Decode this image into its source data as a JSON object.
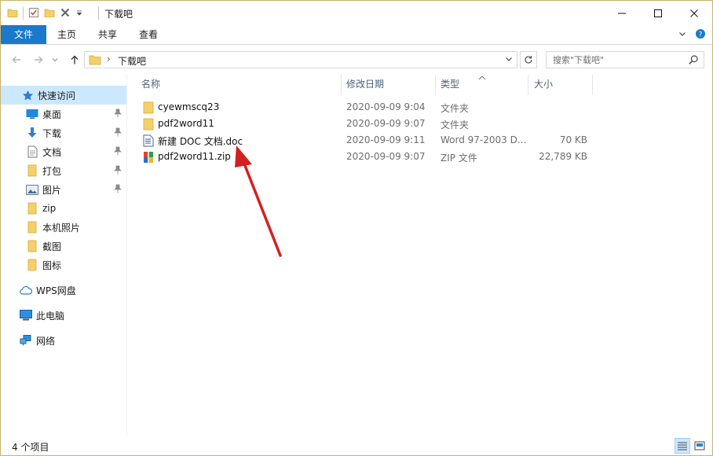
{
  "window": {
    "title": "下载吧",
    "controls": {
      "minimize": "minimize-icon",
      "maximize": "maximize-icon",
      "close": "close-icon"
    }
  },
  "ribbon": {
    "tabs": [
      {
        "label": "文件",
        "active": true
      },
      {
        "label": "主页"
      },
      {
        "label": "共享"
      },
      {
        "label": "查看"
      }
    ],
    "accent": "#1979ca"
  },
  "address": {
    "path": "下载吧",
    "search_placeholder": "搜索\"下载吧\""
  },
  "sidebar": {
    "quick_access": "快速访问",
    "items": [
      {
        "label": "桌面",
        "icon": "desktop-icon",
        "pinned": true
      },
      {
        "label": "下载",
        "icon": "download-icon",
        "pinned": true
      },
      {
        "label": "文档",
        "icon": "document-icon",
        "pinned": true
      },
      {
        "label": "打包",
        "icon": "folder-icon",
        "pinned": true
      },
      {
        "label": "图片",
        "icon": "pictures-icon",
        "pinned": true
      },
      {
        "label": "zip",
        "icon": "folder-icon"
      },
      {
        "label": "本机照片",
        "icon": "folder-icon"
      },
      {
        "label": "截图",
        "icon": "folder-icon"
      },
      {
        "label": "图标",
        "icon": "folder-icon"
      }
    ],
    "wps": "WPS网盘",
    "pc": "此电脑",
    "network": "网络"
  },
  "columns": {
    "name": "名称",
    "date": "修改日期",
    "type": "类型",
    "size": "大小"
  },
  "files": [
    {
      "name": "cyewmscq23",
      "date": "2020-09-09 9:04",
      "type": "文件夹",
      "size": "",
      "icon": "folder-icon"
    },
    {
      "name": "pdf2word11",
      "date": "2020-09-09 9:07",
      "type": "文件夹",
      "size": "",
      "icon": "folder-icon"
    },
    {
      "name": "新建 DOC 文档.doc",
      "date": "2020-09-09 9:11",
      "type": "Word 97-2003 D...",
      "size": "70 KB",
      "icon": "word-doc-icon"
    },
    {
      "name": "pdf2word11.zip",
      "date": "2020-09-09 9:07",
      "type": "ZIP 文件",
      "size": "22,789 KB",
      "icon": "zip-archive-icon"
    }
  ],
  "status": {
    "count": "4 个项目"
  }
}
